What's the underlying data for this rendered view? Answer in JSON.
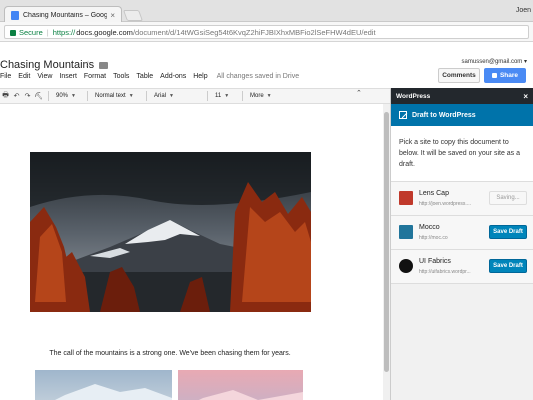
{
  "browser": {
    "tab_title": "Chasing Mountains – Google D",
    "tab_close": "×",
    "profile": "Joen",
    "secure_label": "Secure",
    "url_scheme": "https://",
    "url_domain": "docs.google.com",
    "url_path": "/document/d/14tWGsiSeg54t6KvqZ2hiFJBIXhxMBFio2lSeFHW4dEU/edit"
  },
  "docs": {
    "title": "Chasing Mountains",
    "star_icon": "☆",
    "account_email": "samussen@gmail.com ▾",
    "menu": [
      "File",
      "Edit",
      "View",
      "Insert",
      "Format",
      "Tools",
      "Table",
      "Add-ons",
      "Help"
    ],
    "saved_status": "All changes saved in Drive",
    "comments_label": "Comments",
    "share_label": "Share"
  },
  "toolbar": {
    "icons": [
      "🖶",
      "↶",
      "↷",
      "⛏"
    ],
    "zoom": "90%",
    "style": "Normal text",
    "font": "Arial",
    "size": "11",
    "more": "More",
    "collapse_icon": "⌃"
  },
  "document": {
    "caption": "The call of the mountains is a strong one. We've been chasing them for years."
  },
  "wordpress": {
    "header": "WordPress",
    "close": "×",
    "tab_label": "Draft to WordPress",
    "intro": "Pick a site to copy this document to below. It will be saved on your site as a draft.",
    "sites": [
      {
        "name": "Lens Cap",
        "url": "http://joen.wordpress....",
        "button": "Saving...",
        "icon_color": "#c0392b",
        "state": "saving"
      },
      {
        "name": "Mocco",
        "url": "http://moc.co",
        "button": "Save Draft",
        "icon_color": "#21759b",
        "state": "ready"
      },
      {
        "name": "UI Fabrics",
        "url": "http://uifabrics.wordpr...",
        "button": "Save Draft",
        "icon_color": "#111111",
        "state": "ready"
      }
    ]
  },
  "colors": {
    "wp_blue": "#0073aa",
    "wp_dark": "#23282d",
    "share_blue": "#4a8af4",
    "secure_green": "#0b8043"
  }
}
